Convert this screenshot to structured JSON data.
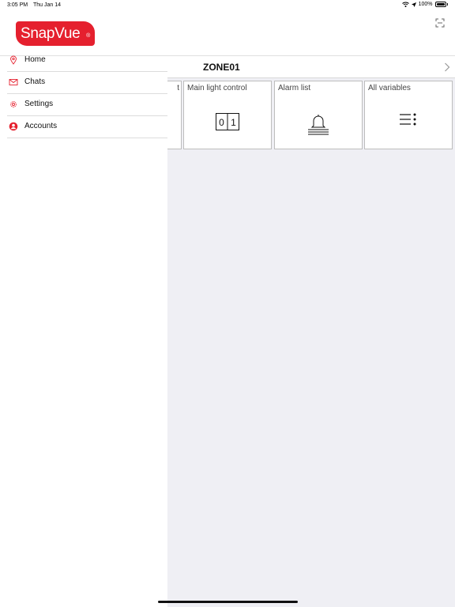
{
  "status_bar": {
    "time": "3:05 PM",
    "date": "Thu Jan 14",
    "battery": "100%"
  },
  "header": {
    "logo_text": "SnapVue",
    "logo_mark": "®",
    "brand_color": "#e5202e"
  },
  "drawer": {
    "items": [
      {
        "label": "Home",
        "icon": "location-pin-icon"
      },
      {
        "label": "Chats",
        "icon": "envelope-icon"
      },
      {
        "label": "Settings",
        "icon": "gear-icon"
      },
      {
        "label": "Accounts",
        "icon": "user-circle-icon"
      }
    ]
  },
  "zone": {
    "title": "ZONE01"
  },
  "tiles": [
    {
      "label": "t"
    },
    {
      "label": "Main light control",
      "icon": "switch-01-icon",
      "switch_off": "0",
      "switch_on": "1"
    },
    {
      "label": "Alarm list",
      "icon": "bell-icon"
    },
    {
      "label": "All variables",
      "icon": "list-icon"
    }
  ]
}
